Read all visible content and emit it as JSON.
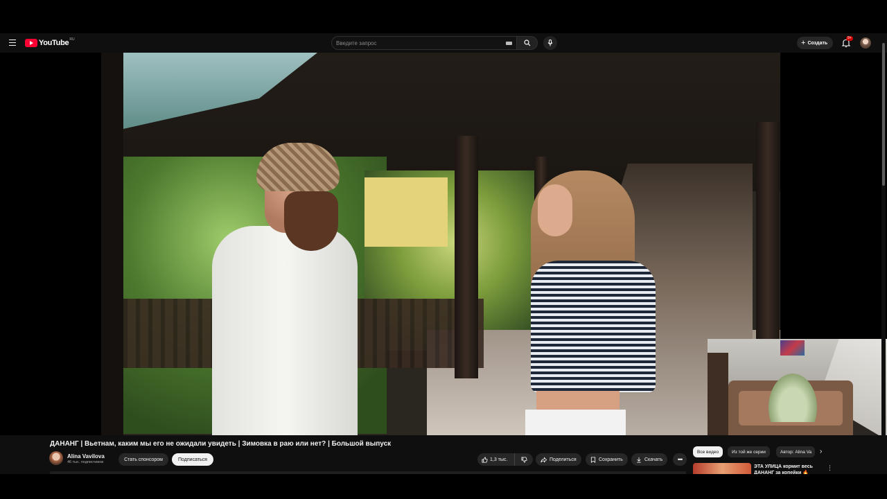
{
  "header": {
    "logo_text": "YouTube",
    "region": "RU",
    "search_placeholder": "Введите запрос",
    "create_label": "Создать",
    "notifications_badge": "9+"
  },
  "video": {
    "title": "ДАНАНГ | Вьетнам, каким мы его не ожидали увидеть | Зимовка в раю или нет? | Большой выпуск"
  },
  "channel": {
    "name": "Alina Vavilova",
    "subscribers": "46 тыс. подписчиков",
    "sponsor_label": "Стать спонсором",
    "subscribe_label": "Подписаться"
  },
  "actions": {
    "likes": "1,3 тыс.",
    "share_label": "Поделиться",
    "save_label": "Сохранить",
    "download_label": "Скачать",
    "more_label": "•••"
  },
  "sidebar": {
    "chips": [
      {
        "label": "Все видео",
        "active": true
      },
      {
        "label": "Из той же серии",
        "active": false
      },
      {
        "label": "Автор: Alina Va",
        "active": false
      }
    ],
    "next_icon": "›",
    "recommendation": {
      "title": "ЭТА УЛИЦА кормит весь ДАНАНГ за копейки 🔥"
    }
  },
  "colors": {
    "brand": "#ff0033",
    "background": "#0f0f0f",
    "chip_bg": "#272727"
  }
}
